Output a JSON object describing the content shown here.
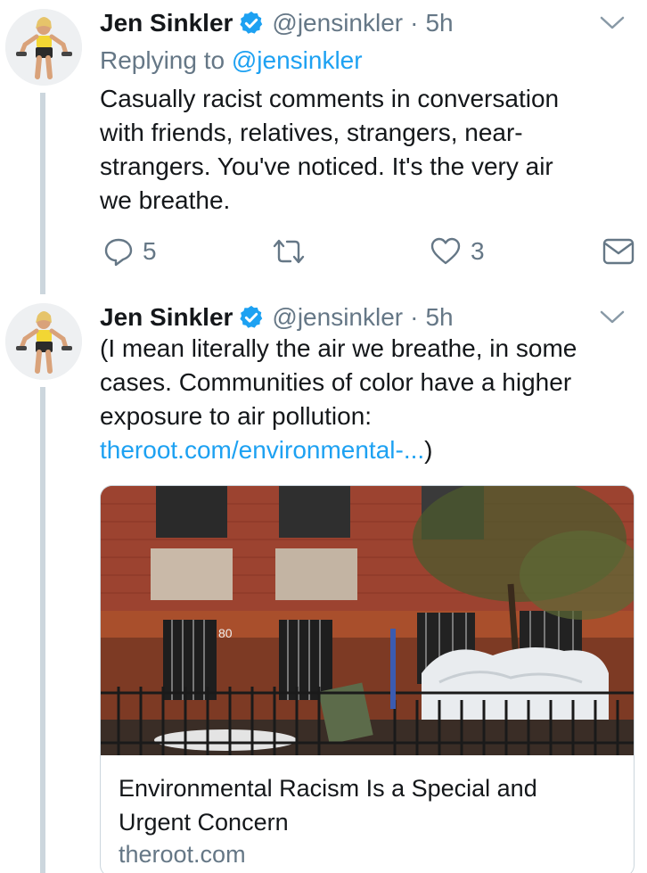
{
  "tweets": [
    {
      "display_name": "Jen Sinkler",
      "handle": "@jensinkler",
      "separator": "·",
      "time": "5h",
      "replying_label": "Replying to",
      "replying_handle": "@jensinkler",
      "text_lines": [
        "Casually racist comments in conversation",
        "with friends, relatives, strangers, near-",
        "strangers. You've noticed. It's the very air",
        "we breathe."
      ],
      "reply_count": "5",
      "like_count": "3"
    },
    {
      "display_name": "Jen Sinkler",
      "handle": "@jensinkler",
      "separator": "·",
      "time": "5h",
      "text_lines": [
        "(I mean literally the air we breathe, in some",
        "cases. Communities of color have a higher",
        "exposure to air pollution:"
      ],
      "link_text": "theroot.com/environmental-...",
      "link_suffix": ")",
      "card": {
        "title_lines": [
          "Environmental Racism Is a Special and",
          "Urgent Concern"
        ],
        "domain": "theroot.com",
        "image_subject": "red brick building with barred windows and a wrought-iron fence",
        "door_number": "80"
      }
    }
  ],
  "icons": {
    "verified": "verified-badge-icon",
    "caret": "chevron-down-icon",
    "reply": "reply-icon",
    "retweet": "retweet-icon",
    "like": "heart-icon",
    "dm": "envelope-icon"
  },
  "colors": {
    "link_blue": "#1da1f2",
    "secondary_text": "#657786",
    "thread_line": "#ccd6dd"
  }
}
